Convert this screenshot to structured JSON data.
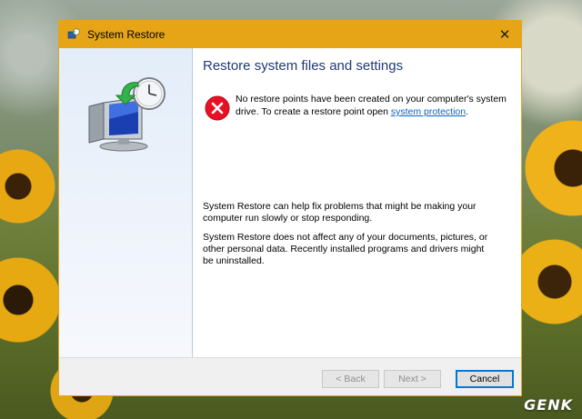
{
  "window": {
    "title": "System Restore",
    "close_label": "✕"
  },
  "content": {
    "heading": "Restore system files and settings",
    "error_text_before": "No restore points have been created on your computer's system drive. To create a restore point open ",
    "error_link": "system protection",
    "error_text_after": ".",
    "paragraph1": "System Restore can help fix problems that might be making your computer run slowly or stop responding.",
    "paragraph2": "System Restore does not affect any of your documents, pictures, or other personal data. Recently installed programs and drivers might be uninstalled."
  },
  "buttons": {
    "back": "< Back",
    "next": "Next >",
    "cancel": "Cancel"
  },
  "icons": {
    "title": "system-restore-icon",
    "hero": "computer-clock-restore-icon",
    "error": "error-icon",
    "close": "close-icon"
  },
  "colors": {
    "titlebar": "#e6a516",
    "heading": "#1e3a78",
    "error": "#e81123",
    "link": "#0a63c7",
    "cancel_focus": "#0078d7"
  },
  "watermark": "GENK"
}
